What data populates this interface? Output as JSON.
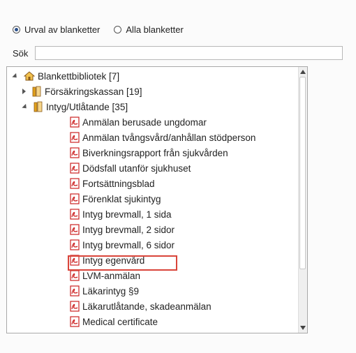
{
  "filter": {
    "option_selected": "Urval av blanketter",
    "option_other": "Alla blanketter"
  },
  "search": {
    "label": "Sök",
    "value": ""
  },
  "tree": {
    "root": "Blankettbibliotek [7]",
    "folders": [
      {
        "label": "Försäkringskassan [19]"
      },
      {
        "label": "Intyg/Utlåtande [35]"
      }
    ],
    "files": [
      "Anmälan berusade ungdomar",
      "Anmälan tvångsvård/anhållan stödperson",
      "Biverkningsrapport från sjukvården",
      "Dödsfall utanför sjukhuset",
      "Fortsättningsblad",
      "Förenklat sjukintyg",
      "Intyg brevmall, 1 sida",
      "Intyg brevmall, 2 sidor",
      "Intyg brevmall, 6 sidor",
      "Intyg egenvård",
      "LVM-anmälan",
      "Läkarintyg §9",
      "Läkarutlåtande, skadeanmälan",
      "Medical certificate"
    ]
  },
  "colors": {
    "highlight": "#d9443a",
    "pdf": "#cc2222",
    "folder": "#e3a21a"
  }
}
